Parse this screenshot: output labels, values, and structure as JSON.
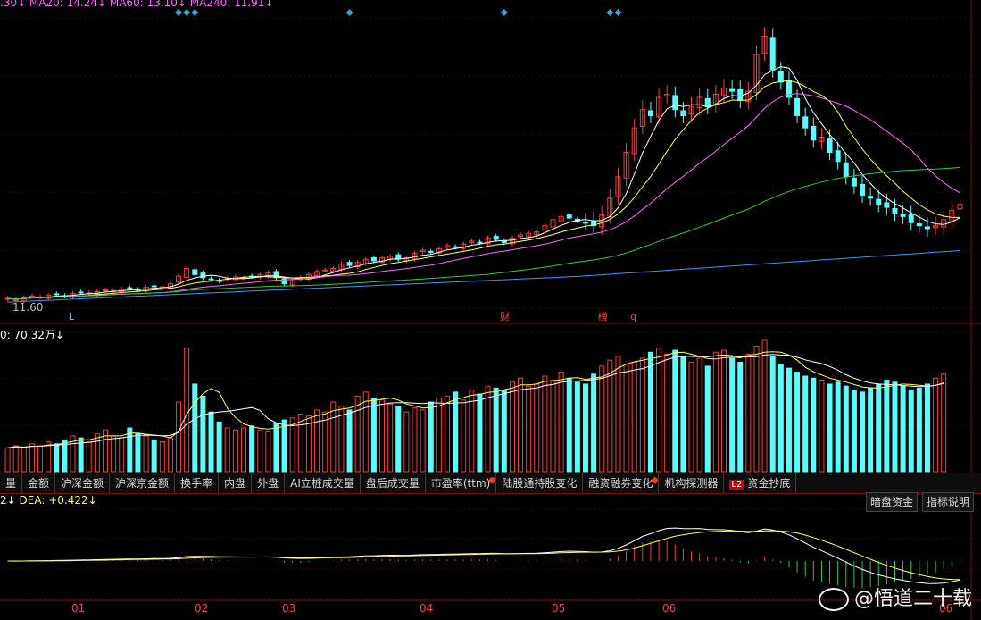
{
  "header": {
    "ma_top_text": ".30↓ MA20: 14.24↓ MA60: 13.10↓ MA240: 11.91↓"
  },
  "price_panel": {
    "low_label": "11.60",
    "markers": [
      {
        "idx": 8,
        "text": "L",
        "color": "#3fd6ff"
      },
      {
        "idx": 61,
        "text": "财",
        "color": "#ff4040"
      },
      {
        "idx": 73,
        "text": "榜",
        "color": "#ff4040"
      },
      {
        "idx": 77,
        "text": "q",
        "color": "#ff4040"
      }
    ],
    "top_diamonds": [
      21,
      22,
      23,
      42,
      61,
      74,
      75
    ]
  },
  "volume_panel": {
    "label": "0: 70.32万↓"
  },
  "macd_panel": {
    "label_pre": "2↓",
    "dea_label": "DEA: +0.422↓"
  },
  "x_labels": [
    "01",
    "02",
    "03",
    "04",
    "05",
    "06",
    "06"
  ],
  "tabs": [
    "量",
    "金额",
    "沪深金额",
    "沪深京金额",
    "换手率",
    "内盘",
    "外盘",
    "AI立桩成交量",
    "盘后成交量",
    "市盈率(ttm)",
    "陆股通持股变化",
    "融资融券变化",
    "机构探测器",
    "资金抄底"
  ],
  "tab_badge_l2": "L2",
  "right_buttons": {
    "dark_pool": "暗盘资金",
    "indicator_help": "指标说明"
  },
  "watermark": "@悟道二十载",
  "colors": {
    "up": "#ff3b3b",
    "down": "#54ffff",
    "ma5": "#ffffff",
    "ma10": "#ffff55",
    "ma20": "#ff66ff",
    "ma60": "#33cc33",
    "ma240": "#3399ff"
  },
  "chart_data": [
    {
      "type": "candlestick",
      "series": [
        {
          "name": "K",
          "values_close": [
            11.62,
            11.58,
            11.64,
            11.7,
            11.66,
            11.72,
            11.75,
            11.7,
            11.78,
            11.82,
            11.8,
            11.85,
            11.9,
            11.88,
            11.92,
            11.95,
            11.9,
            11.98,
            12.02,
            12.0,
            12.1,
            12.35,
            12.6,
            12.4,
            12.3,
            12.25,
            12.2,
            12.28,
            12.32,
            12.3,
            12.35,
            12.4,
            12.45,
            12.3,
            12.1,
            12.2,
            12.3,
            12.4,
            12.5,
            12.55,
            12.6,
            12.75,
            12.7,
            12.8,
            12.9,
            12.85,
            12.95,
            13.0,
            12.9,
            12.95,
            13.1,
            13.2,
            13.15,
            13.25,
            13.35,
            13.3,
            13.4,
            13.5,
            13.45,
            13.6,
            13.55,
            13.45,
            13.6,
            13.7,
            13.75,
            13.8,
            14.0,
            14.2,
            14.3,
            14.25,
            14.15,
            14.1,
            14.0,
            14.35,
            14.9,
            15.6,
            16.4,
            17.2,
            17.8,
            17.6,
            18.2,
            18.3,
            17.8,
            17.6,
            17.9,
            18.2,
            17.9,
            18.3,
            18.5,
            18.4,
            18.1,
            18.4,
            19.6,
            20.2,
            19.1,
            18.7,
            18.2,
            17.6,
            17.2,
            16.8,
            16.9,
            16.4,
            16.1,
            15.6,
            15.3,
            15.0,
            14.9,
            14.7,
            14.6,
            14.4,
            14.3,
            14.1,
            14.0,
            13.9,
            14.0,
            14.2,
            14.5,
            14.7
          ]
        }
      ],
      "ma": [
        "MA5",
        "MA10",
        "MA20",
        "MA60",
        "MA240"
      ]
    },
    {
      "type": "bar",
      "series": [
        {
          "name": "VOL",
          "values": [
            12,
            13,
            12,
            14,
            13,
            15,
            14,
            16,
            18,
            17,
            15,
            19,
            21,
            18,
            17,
            22,
            19,
            18,
            16,
            15,
            17,
            35,
            62,
            44,
            38,
            30,
            25,
            22,
            21,
            22,
            23,
            21,
            20,
            24,
            26,
            27,
            29,
            28,
            31,
            30,
            35,
            33,
            31,
            38,
            40,
            37,
            36,
            34,
            33,
            30,
            32,
            31,
            35,
            37,
            38,
            40,
            36,
            41,
            39,
            43,
            42,
            41,
            45,
            47,
            43,
            44,
            48,
            46,
            50,
            47,
            45,
            44,
            49,
            53,
            56,
            58,
            54,
            55,
            57,
            60,
            62,
            59,
            61,
            58,
            55,
            57,
            53,
            60,
            61,
            57,
            55,
            59,
            63,
            66,
            58,
            54,
            52,
            50,
            48,
            47,
            46,
            44,
            45,
            43,
            41,
            40,
            42,
            44,
            46,
            45,
            43,
            41,
            42,
            44,
            47,
            49
          ]
        }
      ]
    },
    {
      "type": "line",
      "series": [
        {
          "name": "DIF"
        },
        {
          "name": "DEA"
        },
        {
          "name": "MACD"
        }
      ]
    }
  ]
}
